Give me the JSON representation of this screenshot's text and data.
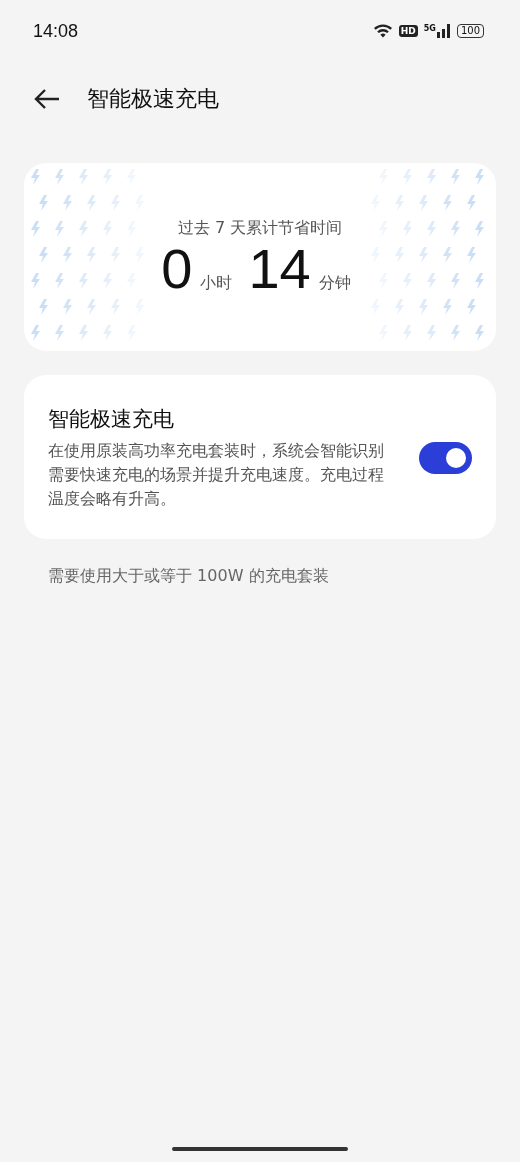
{
  "status_bar": {
    "time": "14:08",
    "hd_badge": "HD",
    "network": "5G",
    "battery": "100"
  },
  "header": {
    "title": "智能极速充电"
  },
  "summary": {
    "caption": "过去 7 天累计节省时间",
    "hours": "0",
    "hours_unit": "小时",
    "minutes": "14",
    "minutes_unit": "分钟"
  },
  "setting": {
    "title": "智能极速充电",
    "description": "在使用原装高功率充电套装时，系统会智能识别需要快速充电的场景并提升充电速度。充电过程温度会略有升高。",
    "on": true
  },
  "footnote": "需要使用大于或等于 100W 的充电套装"
}
